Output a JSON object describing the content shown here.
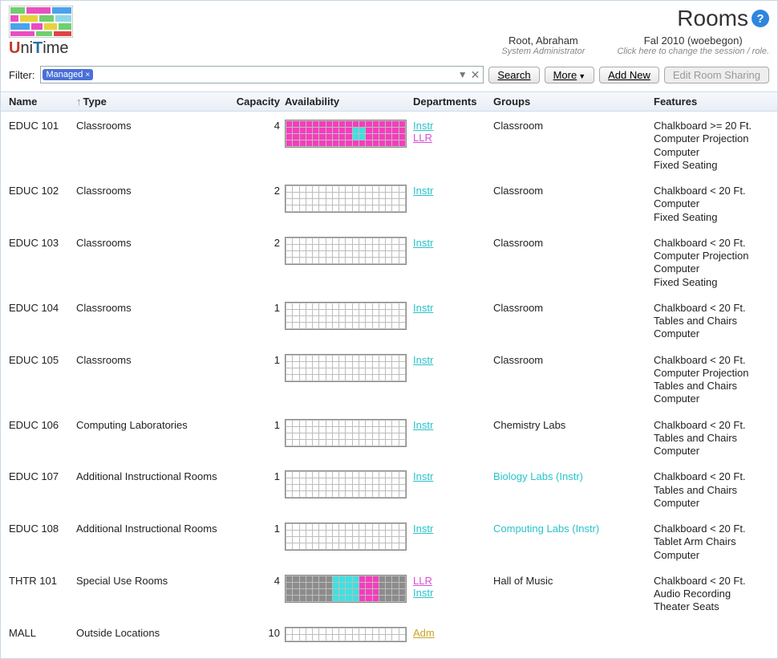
{
  "header": {
    "page_title": "Rooms",
    "user_name": "Root, Abraham",
    "user_role": "System Administrator",
    "session_name": "Fal 2010 (woebegon)",
    "session_hint": "Click here to change the session / role."
  },
  "filter": {
    "label": "Filter:",
    "chip_label": "Managed",
    "search": "Search",
    "more": "More",
    "add_new": "Add New",
    "edit_sharing": "Edit Room Sharing"
  },
  "columns": {
    "name": "Name",
    "type": "Type",
    "capacity": "Capacity",
    "availability": "Availability",
    "departments": "Departments",
    "groups": "Groups",
    "features": "Features",
    "sort_indicator": "↑"
  },
  "rows": [
    {
      "name": "EDUC 101",
      "type": "Classrooms",
      "capacity": "4",
      "availability": {
        "rows": 4,
        "cols": 18,
        "pattern": "pink_with_cyan"
      },
      "departments": [
        {
          "label": "Instr",
          "class": "dep-instr"
        },
        {
          "label": "LLR",
          "class": "dep-llr"
        }
      ],
      "groups": [
        {
          "label": "Classroom",
          "link": false
        }
      ],
      "features": [
        "Chalkboard >= 20 Ft.",
        "Computer Projection",
        "Computer",
        "Fixed Seating"
      ]
    },
    {
      "name": "EDUC 102",
      "type": "Classrooms",
      "capacity": "2",
      "availability": {
        "rows": 4,
        "cols": 18,
        "pattern": "empty"
      },
      "departments": [
        {
          "label": "Instr",
          "class": "dep-instr"
        }
      ],
      "groups": [
        {
          "label": "Classroom",
          "link": false
        }
      ],
      "features": [
        "Chalkboard < 20 Ft.",
        "Computer",
        "Fixed Seating"
      ]
    },
    {
      "name": "EDUC 103",
      "type": "Classrooms",
      "capacity": "2",
      "availability": {
        "rows": 4,
        "cols": 18,
        "pattern": "empty"
      },
      "departments": [
        {
          "label": "Instr",
          "class": "dep-instr"
        }
      ],
      "groups": [
        {
          "label": "Classroom",
          "link": false
        }
      ],
      "features": [
        "Chalkboard < 20 Ft.",
        "Computer Projection",
        "Computer",
        "Fixed Seating"
      ]
    },
    {
      "name": "EDUC 104",
      "type": "Classrooms",
      "capacity": "1",
      "availability": {
        "rows": 4,
        "cols": 18,
        "pattern": "empty"
      },
      "departments": [
        {
          "label": "Instr",
          "class": "dep-instr"
        }
      ],
      "groups": [
        {
          "label": "Classroom",
          "link": false
        }
      ],
      "features": [
        "Chalkboard < 20 Ft.",
        "Tables and Chairs",
        "Computer"
      ]
    },
    {
      "name": "EDUC 105",
      "type": "Classrooms",
      "capacity": "1",
      "availability": {
        "rows": 4,
        "cols": 18,
        "pattern": "empty"
      },
      "departments": [
        {
          "label": "Instr",
          "class": "dep-instr"
        }
      ],
      "groups": [
        {
          "label": "Classroom",
          "link": false
        }
      ],
      "features": [
        "Chalkboard < 20 Ft.",
        "Computer Projection",
        "Tables and Chairs",
        "Computer"
      ]
    },
    {
      "name": "EDUC 106",
      "type": "Computing Laboratories",
      "capacity": "1",
      "availability": {
        "rows": 4,
        "cols": 18,
        "pattern": "empty"
      },
      "departments": [
        {
          "label": "Instr",
          "class": "dep-instr"
        }
      ],
      "groups": [
        {
          "label": "Chemistry Labs",
          "link": false
        }
      ],
      "features": [
        "Chalkboard < 20 Ft.",
        "Tables and Chairs",
        "Computer"
      ]
    },
    {
      "name": "EDUC 107",
      "type": "Additional Instructional Rooms",
      "capacity": "1",
      "availability": {
        "rows": 4,
        "cols": 18,
        "pattern": "empty"
      },
      "departments": [
        {
          "label": "Instr",
          "class": "dep-instr"
        }
      ],
      "groups": [
        {
          "label": "Biology Labs (Instr)",
          "link": true
        }
      ],
      "features": [
        "Chalkboard < 20 Ft.",
        "Tables and Chairs",
        "Computer"
      ]
    },
    {
      "name": "EDUC 108",
      "type": "Additional Instructional Rooms",
      "capacity": "1",
      "availability": {
        "rows": 4,
        "cols": 18,
        "pattern": "empty"
      },
      "departments": [
        {
          "label": "Instr",
          "class": "dep-instr"
        }
      ],
      "groups": [
        {
          "label": "Computing Labs (Instr)",
          "link": true
        }
      ],
      "features": [
        "Chalkboard < 20 Ft.",
        "Tablet Arm Chairs",
        "Computer"
      ]
    },
    {
      "name": "THTR 101",
      "type": "Special Use Rooms",
      "capacity": "4",
      "availability": {
        "rows": 4,
        "cols": 18,
        "pattern": "tricolor"
      },
      "departments": [
        {
          "label": "LLR",
          "class": "dep-llr"
        },
        {
          "label": "Instr",
          "class": "dep-instr"
        }
      ],
      "groups": [
        {
          "label": "Hall of Music",
          "link": false
        }
      ],
      "features": [
        "Chalkboard < 20 Ft.",
        "Audio Recording",
        "Theater Seats"
      ]
    },
    {
      "name": "MALL",
      "type": "Outside Locations",
      "capacity": "10",
      "availability": {
        "rows": 2,
        "cols": 18,
        "pattern": "empty"
      },
      "departments": [
        {
          "label": "Adm",
          "class": "dep-adm"
        }
      ],
      "groups": [],
      "features": []
    }
  ],
  "colors": {
    "pink": "#f53dbd",
    "cyan": "#3fe0e0",
    "grey": "#8c8c8c",
    "grid": "#bdbdbd"
  }
}
